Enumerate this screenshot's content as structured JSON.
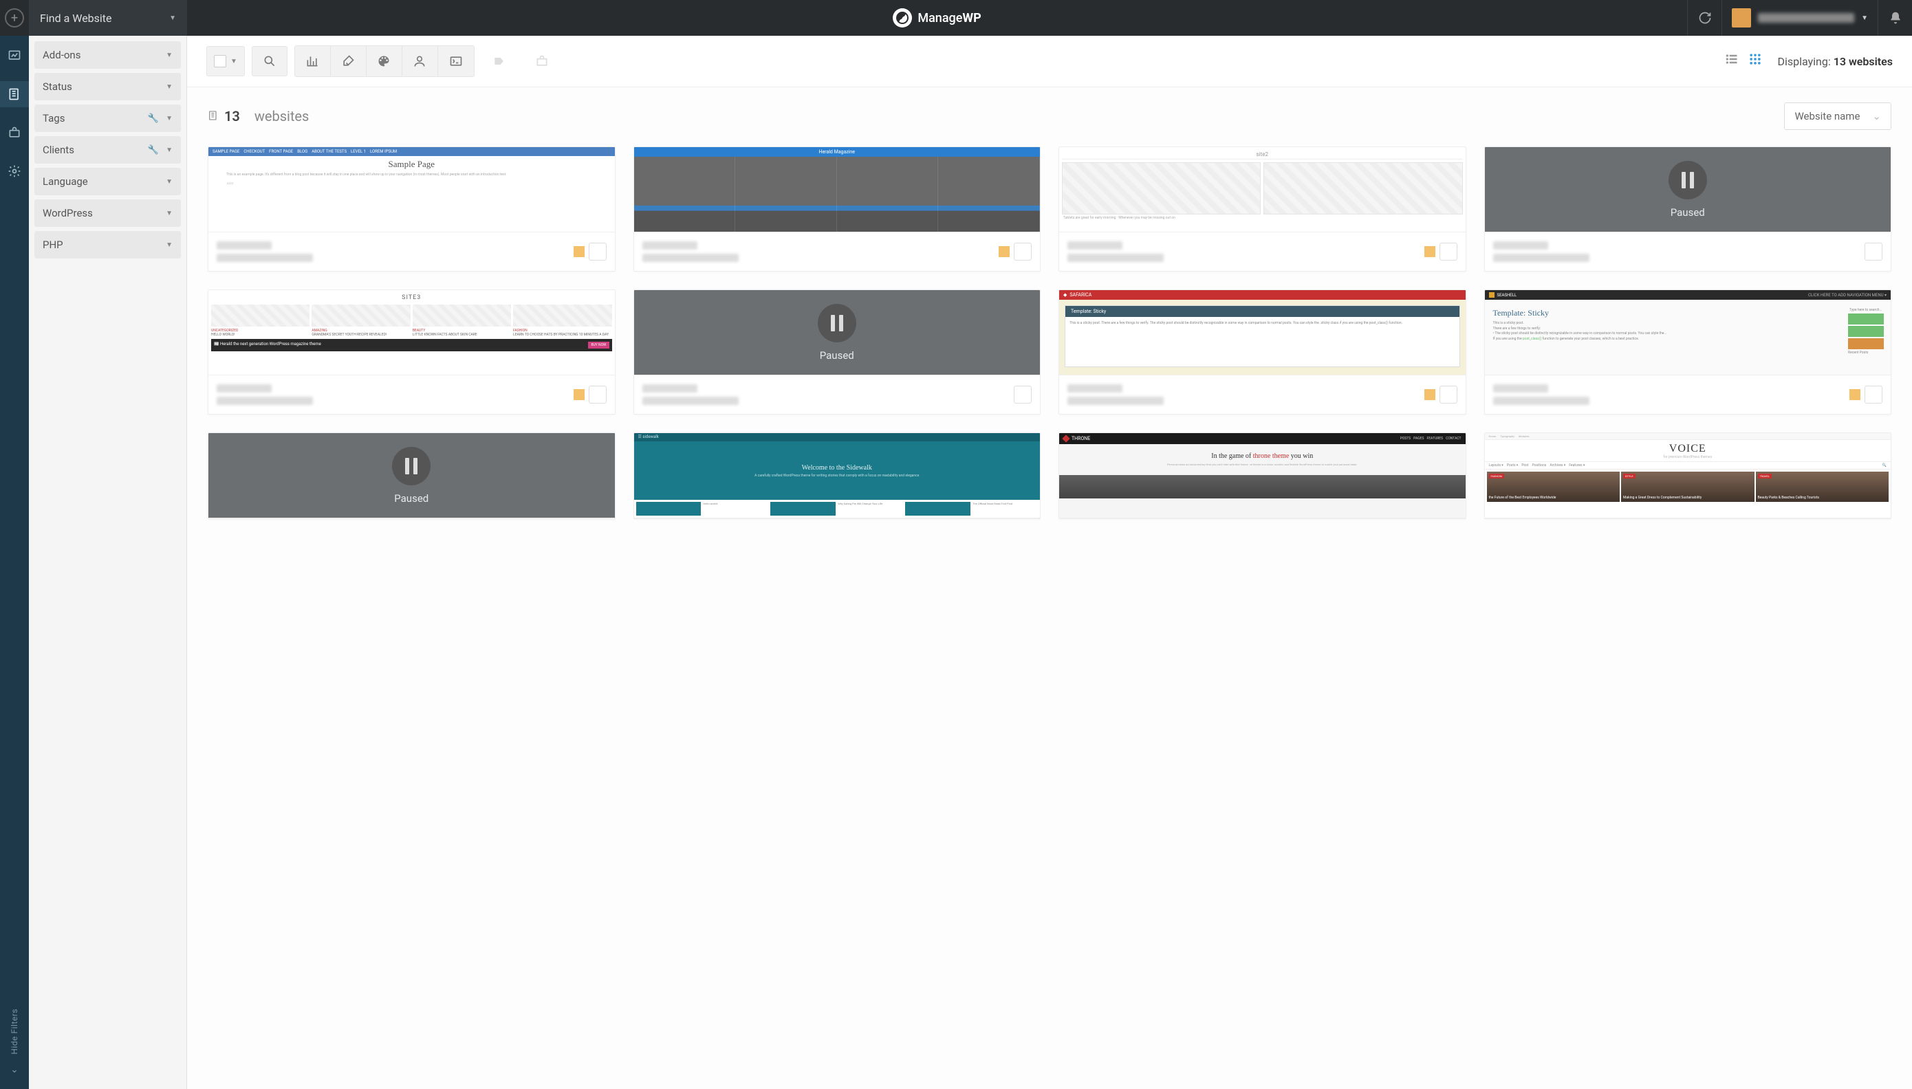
{
  "topbar": {
    "search_label": "Find a Website",
    "brand_prefix": "Manage",
    "brand_suffix": "WP"
  },
  "rail": {
    "hide_filters": "Hide Filters"
  },
  "filters": [
    {
      "label": "Add-ons",
      "wrench": false
    },
    {
      "label": "Status",
      "wrench": false
    },
    {
      "label": "Tags",
      "wrench": true
    },
    {
      "label": "Clients",
      "wrench": true
    },
    {
      "label": "Language",
      "wrench": false
    },
    {
      "label": "WordPress",
      "wrench": false
    },
    {
      "label": "PHP",
      "wrench": false
    }
  ],
  "toolbar": {
    "displaying_prefix": "Displaying: ",
    "displaying_count": "13 websites"
  },
  "content": {
    "count": "13",
    "count_suffix": "websites",
    "sort_label": "Website name"
  },
  "paused_label": "Paused",
  "thumbs": {
    "sample_title": "Sample Page",
    "herald_title": "Herald Magazine",
    "site2_title": "site2",
    "site3_title": "SITE3",
    "site3_c1t": "HELLO WORLD!",
    "site3_c2t": "GRANDMA'S SECRET YOUTH RECIPE REVEALED!",
    "site3_c3t": "LITTLE KNOWN FACTS ABOUT SKIN CARE",
    "site3_c4t": "LEARN TO CHOOSE HATS BY PRACTICING 10 MINUTES A DAY",
    "site3_banner": "Herald",
    "safarica_name": "SAFARICA",
    "safarica_box": "Template: Sticky",
    "seashell_name": "SEASHELL",
    "seashell_title": "Template: Sticky",
    "sidewalk_name": "sidewalk",
    "sidewalk_title": "Welcome to the Sidewalk",
    "sidewalk_sub": "A carefully crafted WordPress theme for writing stories that comply with a focus on readability and elegance",
    "throne_name": "THRONE",
    "throne_line_a": "In the game of ",
    "throne_line_b": "throne theme",
    "throne_line_c": " you win",
    "voice_title": "VOICE"
  }
}
